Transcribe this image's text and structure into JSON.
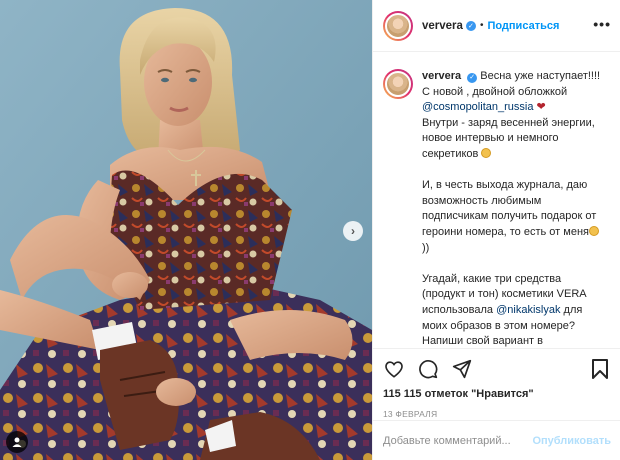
{
  "post": {
    "username": "ververa",
    "follow_label": "Подписаться",
    "more_label": "•••"
  },
  "caption": {
    "username": "ververa",
    "line1": "Весна уже наступает!!!! С новой , двойной обложкой",
    "mention1": "@cosmopolitan_russia",
    "line2": "Внутри - заряд весенней энергии, новое интервью и немного секретиков",
    "line3": "И, в честь выхода журнала, даю возможность любимым подписчикам получить подарок от героини номера, то есть от меня",
    "line3_end": "))",
    "line4a": "Угадай, какие три средства (продукт и тон) косметики VERA использовала",
    "mention2": "@nikakislyak",
    "line4b": "для моих образов в этом номере?",
    "line5": "Напиши свой вариант в комментарии под этим постом и жди. Первый угаданный получит"
  },
  "stats": {
    "likes": "115 115 отметок \"Нравится\"",
    "date": "13 ФЕВРАЛЯ"
  },
  "comment": {
    "placeholder": "Добавьте комментарий...",
    "publish_label": "Опубликовать"
  },
  "icons": {
    "like": "heart-icon",
    "comment": "comment-icon",
    "share": "share-icon",
    "save": "bookmark-icon",
    "next": "chevron-right-icon",
    "tag": "person-tag-icon"
  },
  "colors": {
    "accent": "#0095f6",
    "link": "#00376b",
    "muted": "#8e8e8e",
    "publish_disabled": "#b2dffc",
    "photo_background": "#7aa2b6"
  }
}
